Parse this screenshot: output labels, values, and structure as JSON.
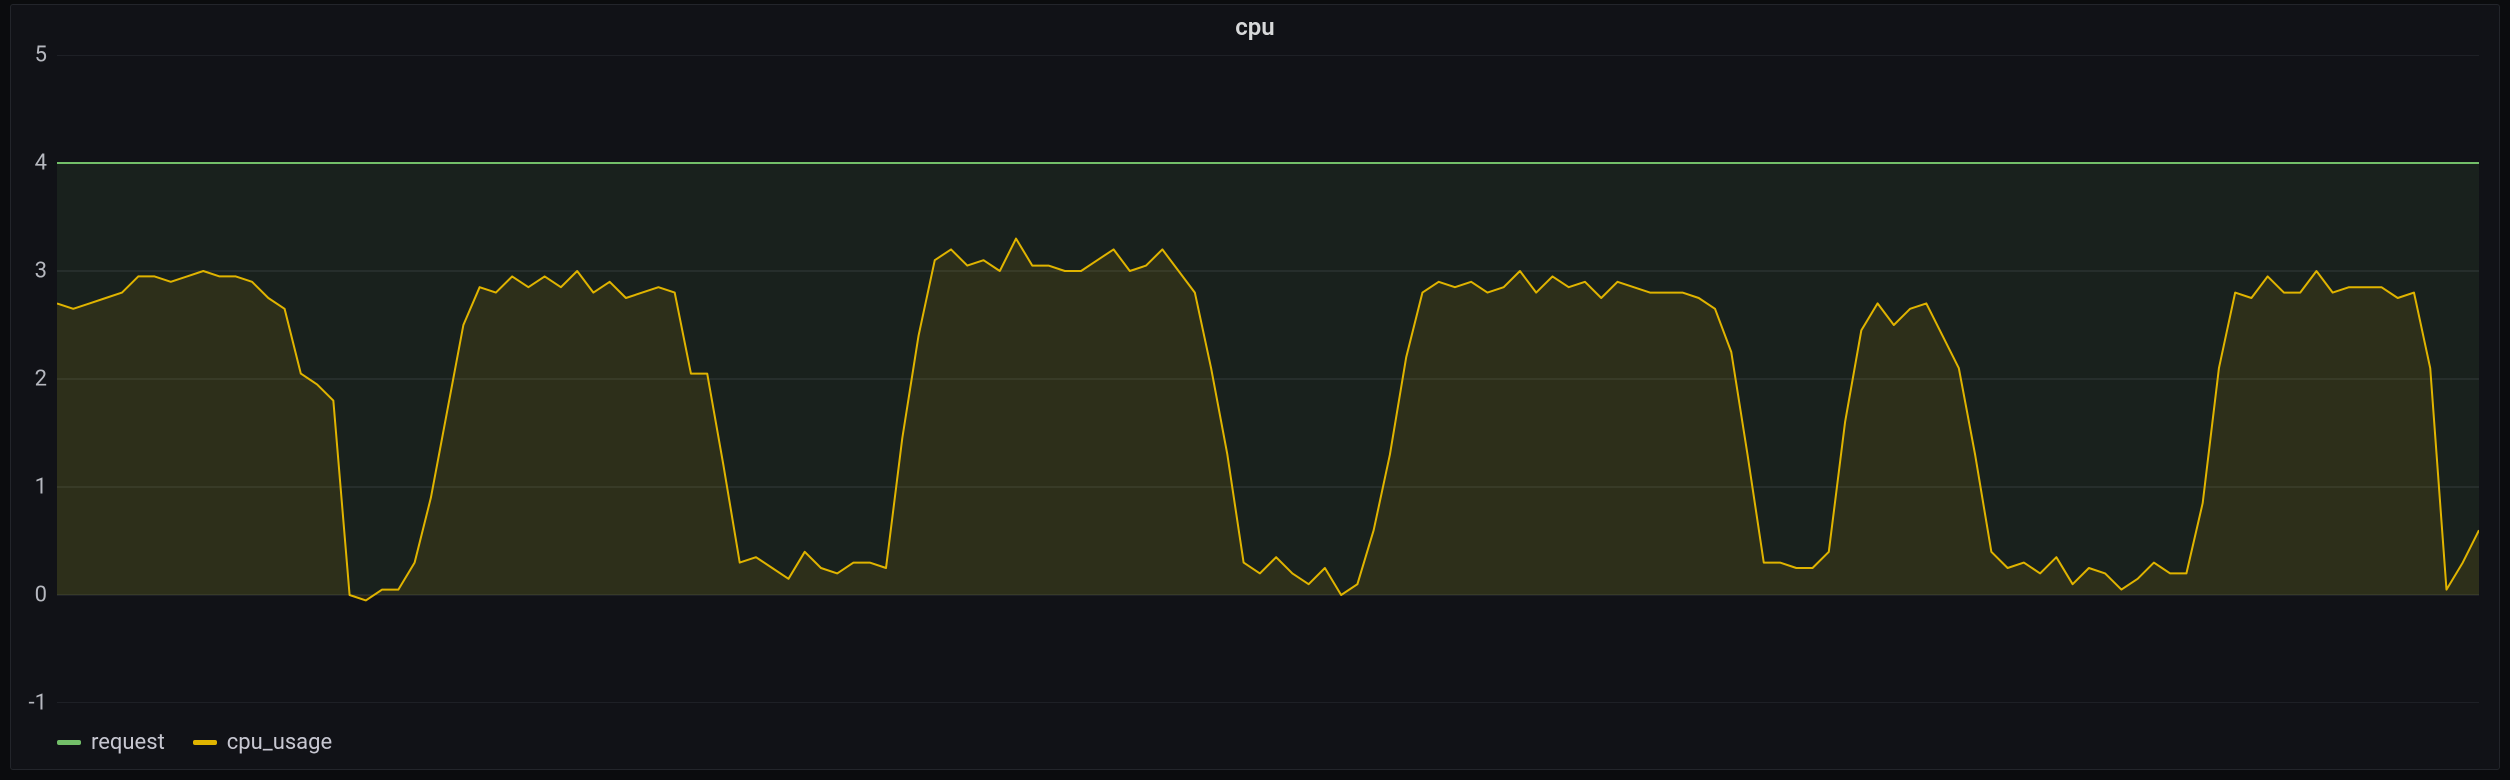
{
  "title": "cpu",
  "legend": {
    "request_label": "request",
    "cpu_usage_label": "cpu_usage"
  },
  "axis": {
    "ymin": -1,
    "ymax": 5,
    "yticks": [
      -1,
      0,
      1,
      2,
      3,
      4,
      5
    ]
  },
  "colors": {
    "request": "#73bf69",
    "cpu_usage": "#e0b400",
    "grid": "#2c2f36",
    "area_fill": "rgba(115,191,105,0.09)"
  },
  "chart_data": {
    "type": "line",
    "title": "cpu",
    "xlabel": "",
    "ylabel": "",
    "ylim": [
      -1,
      5
    ],
    "x": [
      0,
      1,
      2,
      3,
      4,
      5,
      6,
      7,
      8,
      9,
      10,
      11,
      12,
      13,
      14,
      15,
      16,
      17,
      18,
      19,
      20,
      21,
      22,
      23,
      24,
      25,
      26,
      27,
      28,
      29,
      30,
      31,
      32,
      33,
      34,
      35,
      36,
      37,
      38,
      39,
      40,
      41,
      42,
      43,
      44,
      45,
      46,
      47,
      48,
      49,
      50,
      51,
      52,
      53,
      54,
      55,
      56,
      57,
      58,
      59,
      60,
      61,
      62,
      63,
      64,
      65,
      66,
      67,
      68,
      69,
      70,
      71,
      72,
      73,
      74,
      75,
      76,
      77,
      78,
      79,
      80,
      81,
      82,
      83,
      84,
      85,
      86,
      87,
      88,
      89,
      90,
      91,
      92,
      93,
      94,
      95,
      96,
      97,
      98,
      99,
      100,
      101,
      102,
      103,
      104,
      105,
      106,
      107,
      108,
      109,
      110,
      111,
      112,
      113,
      114,
      115,
      116,
      117,
      118,
      119,
      120,
      121,
      122,
      123,
      124,
      125,
      126,
      127,
      128,
      129,
      130,
      131,
      132,
      133,
      134,
      135,
      136,
      137,
      138,
      139,
      140,
      141,
      142,
      143,
      144,
      145,
      146,
      147,
      148,
      149
    ],
    "series": [
      {
        "name": "request",
        "values": [
          4,
          4,
          4,
          4,
          4,
          4,
          4,
          4,
          4,
          4,
          4,
          4,
          4,
          4,
          4,
          4,
          4,
          4,
          4,
          4,
          4,
          4,
          4,
          4,
          4,
          4,
          4,
          4,
          4,
          4,
          4,
          4,
          4,
          4,
          4,
          4,
          4,
          4,
          4,
          4,
          4,
          4,
          4,
          4,
          4,
          4,
          4,
          4,
          4,
          4,
          4,
          4,
          4,
          4,
          4,
          4,
          4,
          4,
          4,
          4,
          4,
          4,
          4,
          4,
          4,
          4,
          4,
          4,
          4,
          4,
          4,
          4,
          4,
          4,
          4,
          4,
          4,
          4,
          4,
          4,
          4,
          4,
          4,
          4,
          4,
          4,
          4,
          4,
          4,
          4,
          4,
          4,
          4,
          4,
          4,
          4,
          4,
          4,
          4,
          4,
          4,
          4,
          4,
          4,
          4,
          4,
          4,
          4,
          4,
          4,
          4,
          4,
          4,
          4,
          4,
          4,
          4,
          4,
          4,
          4,
          4,
          4,
          4,
          4,
          4,
          4,
          4,
          4,
          4,
          4,
          4,
          4,
          4,
          4,
          4,
          4,
          4,
          4,
          4,
          4,
          4,
          4,
          4,
          4,
          4,
          4,
          4,
          4,
          4,
          4
        ]
      },
      {
        "name": "cpu_usage",
        "values": [
          2.7,
          2.65,
          2.7,
          2.75,
          2.8,
          2.95,
          2.95,
          2.9,
          2.95,
          3.0,
          2.95,
          2.95,
          2.9,
          2.75,
          2.65,
          2.05,
          1.95,
          1.8,
          0.0,
          -0.05,
          0.05,
          0.05,
          0.3,
          0.9,
          1.7,
          2.5,
          2.85,
          2.8,
          2.95,
          2.85,
          2.95,
          2.85,
          3.0,
          2.8,
          2.9,
          2.75,
          2.8,
          2.85,
          2.8,
          2.05,
          2.05,
          1.2,
          0.3,
          0.35,
          0.25,
          0.15,
          0.4,
          0.25,
          0.2,
          0.3,
          0.3,
          0.25,
          1.45,
          2.4,
          3.1,
          3.2,
          3.05,
          3.1,
          3.0,
          3.3,
          3.05,
          3.05,
          3.0,
          3.0,
          3.1,
          3.2,
          3.0,
          3.05,
          3.2,
          3.0,
          2.8,
          2.1,
          1.3,
          0.3,
          0.2,
          0.35,
          0.2,
          0.1,
          0.25,
          0.0,
          0.1,
          0.6,
          1.3,
          2.2,
          2.8,
          2.9,
          2.85,
          2.9,
          2.8,
          2.85,
          3.0,
          2.8,
          2.95,
          2.85,
          2.9,
          2.75,
          2.9,
          2.85,
          2.8,
          2.8,
          2.8,
          2.75,
          2.65,
          2.25,
          1.3,
          0.3,
          0.3,
          0.25,
          0.25,
          0.4,
          1.6,
          2.45,
          2.7,
          2.5,
          2.65,
          2.7,
          2.4,
          2.1,
          1.3,
          0.4,
          0.25,
          0.3,
          0.2,
          0.35,
          0.1,
          0.25,
          0.2,
          0.05,
          0.15,
          0.3,
          0.2,
          0.2,
          0.85,
          2.1,
          2.8,
          2.75,
          2.95,
          2.8,
          2.8,
          3.0,
          2.8,
          2.85,
          2.85,
          2.85,
          2.75,
          2.8,
          2.1,
          0.05,
          0.3,
          0.6
        ]
      }
    ]
  }
}
